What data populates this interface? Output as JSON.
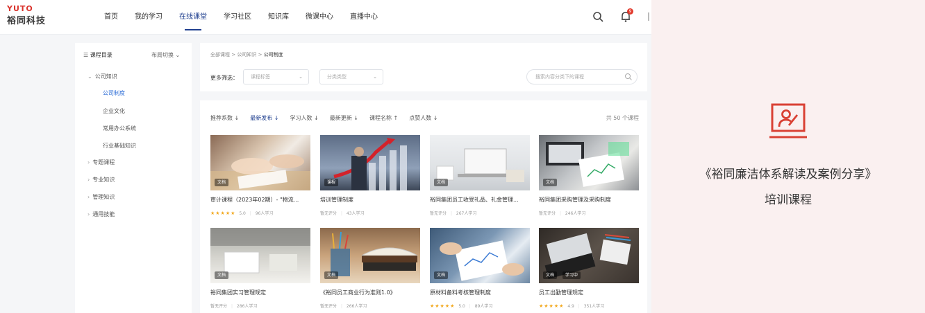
{
  "brand": {
    "logo_text": "YUTO",
    "name": "裕同科技"
  },
  "nav": {
    "items": [
      "首页",
      "我的学习",
      "在线课堂",
      "学习社区",
      "知识库",
      "微课中心",
      "直播中心"
    ],
    "active_index": 2,
    "notification_count": "9"
  },
  "sidebar": {
    "title": "课程目录",
    "switch_label": "布局切换 ⌄",
    "items": [
      {
        "label": "公司知识",
        "prefix": "⌄"
      },
      {
        "label": "公司制度",
        "prefix": ""
      },
      {
        "label": "企业文化",
        "prefix": ""
      },
      {
        "label": "常用办公系统",
        "prefix": ""
      },
      {
        "label": "行业基础知识",
        "prefix": ""
      },
      {
        "label": "专题课程",
        "prefix": "›"
      },
      {
        "label": "专业知识",
        "prefix": "›"
      },
      {
        "label": "管理知识",
        "prefix": "›"
      },
      {
        "label": "通用技能",
        "prefix": "›"
      }
    ]
  },
  "breadcrumb": {
    "parts": [
      "全部课程",
      "公司知识"
    ],
    "current": "公司制度",
    "separator": ">"
  },
  "filters": {
    "label": "更多筛选：",
    "select1_placeholder": "课程标签",
    "select2_placeholder": "分类类型",
    "search_placeholder": "搜索内容分类下的课程"
  },
  "sort": {
    "items": [
      "推荐系数 ↓",
      "最新发布 ↓",
      "学习人数 ↓",
      "最新更新 ↓",
      "课程名称 ↑",
      "点赞人数 ↓"
    ],
    "active_index": 1,
    "count_text": "共 50 个课程"
  },
  "cards": [
    {
      "title": "审计课程（2023年02期）- \"物流...",
      "tag": "文档",
      "tag2": "",
      "rating_stars": "★★★★★",
      "rating": "5.0",
      "meta": "96人学习"
    },
    {
      "title": "培训管理制度",
      "tag": "课程",
      "tag2": "",
      "rating_stars": "",
      "rating": "暂无评分",
      "meta": "43人学习"
    },
    {
      "title": "裕同集团员工收受礼品、礼金管理...",
      "tag": "文档",
      "tag2": "",
      "rating_stars": "",
      "rating": "暂无评分",
      "meta": "267人学习"
    },
    {
      "title": "裕同集团采购管理及采购制度",
      "tag": "文档",
      "tag2": "",
      "rating_stars": "",
      "rating": "暂无评分",
      "meta": "246人学习"
    },
    {
      "title": "裕同集团实习管理规定",
      "tag": "文档",
      "tag2": "",
      "rating_stars": "",
      "rating": "暂无评分",
      "meta": "286人学习"
    },
    {
      "title": "《裕同员工商业行为准则1.0》",
      "tag": "文档",
      "tag2": "",
      "rating_stars": "",
      "rating": "暂无评分",
      "meta": "266人学习"
    },
    {
      "title": "原材料备料考核管理制度",
      "tag": "文档",
      "tag2": "",
      "rating_stars": "★★★★★",
      "rating": "5.0",
      "meta": "89人学习"
    },
    {
      "title": "员工出勤管理规定",
      "tag": "文档",
      "tag2": "学习中",
      "rating_stars": "★★★★★",
      "rating": "4.9",
      "meta": "351人学习"
    }
  ],
  "promo": {
    "title": "《裕同廉洁体系解读及案例分享》",
    "subtitle": "培训课程"
  },
  "colors": {
    "brand_red": "#d9332c",
    "primary": "#1f3f8f",
    "link_blue": "#2a6bd6",
    "star": "#f2a81d",
    "promo_bg": "#faf0f0"
  }
}
